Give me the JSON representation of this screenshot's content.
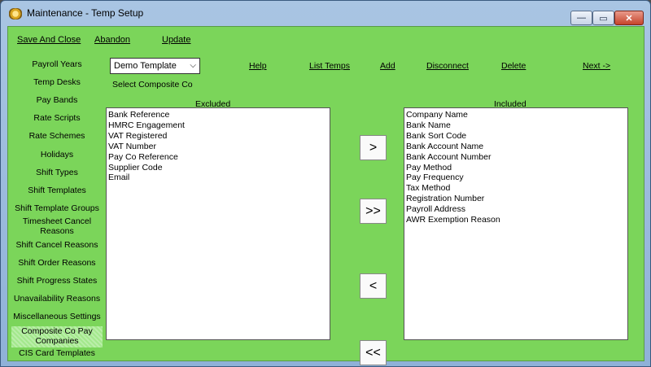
{
  "window": {
    "title": "Maintenance - Temp Setup",
    "controls": {
      "minimize": "—",
      "maximize": "▭",
      "close": "✕"
    }
  },
  "menubar": {
    "save_and_close": "Save And Close",
    "abandon": "Abandon",
    "update": "Update"
  },
  "sidebar": {
    "items": [
      "Payroll Years",
      "Temp Desks",
      "Pay Bands",
      "Rate Scripts",
      "Rate Schemes",
      "Holidays",
      "Shift Types",
      "Shift Templates",
      "Shift Template Groups",
      "Timesheet Cancel Reasons",
      "Shift Cancel Reasons",
      "Shift Order Reasons",
      "Shift Progress States",
      "Unavailability Reasons",
      "Miscellaneous Settings",
      "Composite Co Pay Companies",
      "CIS Card Templates"
    ],
    "selected": "Composite Co Pay Companies",
    "scroll_arrow": "▼"
  },
  "main": {
    "template_select": {
      "value": "Demo Template",
      "chevron": "⌵"
    },
    "select_label": "Select Composite Co",
    "links": {
      "help": "Help",
      "list_temps": "List Temps",
      "add": "Add",
      "disconnect": "Disconnect",
      "delete": "Delete",
      "next": "Next ->"
    },
    "excluded": {
      "header": "Excluded",
      "items": [
        "Bank Reference",
        "HMRC Engagement",
        "VAT Registered",
        "VAT Number",
        "Pay Co Reference",
        "Supplier Code",
        "Email"
      ]
    },
    "included": {
      "header": "Included",
      "items": [
        "Company Name",
        "Bank Name",
        "Bank Sort Code",
        "Bank Account Name",
        "Bank Account Number",
        "Pay Method",
        "Pay Frequency",
        "Tax Method",
        "Registration Number",
        "Payroll Address",
        "AWR Exemption Reason"
      ]
    },
    "buttons": {
      "move_right": ">",
      "move_all_right": ">>",
      "move_left": "<",
      "move_all_left": "<<"
    }
  }
}
